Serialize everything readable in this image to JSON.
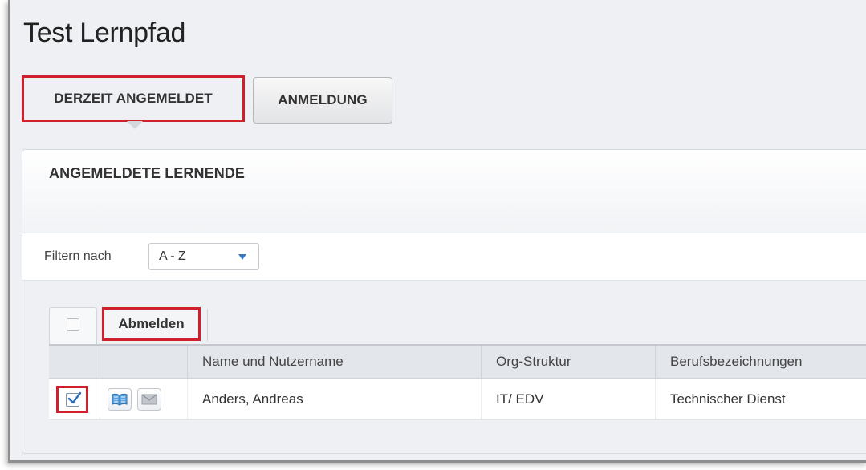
{
  "page": {
    "title": "Test Lernpfad"
  },
  "tabs": {
    "current": "DERZEIT ANGEMELDET",
    "enroll": "ANMELDUNG"
  },
  "panel": {
    "title": "ANGEMELDETE LERNENDE",
    "filter": {
      "label": "Filtern nach",
      "selected": "A - Z"
    }
  },
  "toolbar": {
    "unenroll_label": "Abmelden"
  },
  "table": {
    "columns": [
      "",
      "",
      "Name und Nutzername",
      "Org-Struktur",
      "Berufsbezeichnungen"
    ],
    "rows": [
      {
        "checked": true,
        "name": "Anders, Andreas",
        "org": "IT/ EDV",
        "job": "Technischer Dienst",
        "icons": [
          "book-icon",
          "mail-icon"
        ]
      }
    ]
  },
  "colors": {
    "highlight": "#d0202c",
    "accent": "#3a78c3"
  }
}
